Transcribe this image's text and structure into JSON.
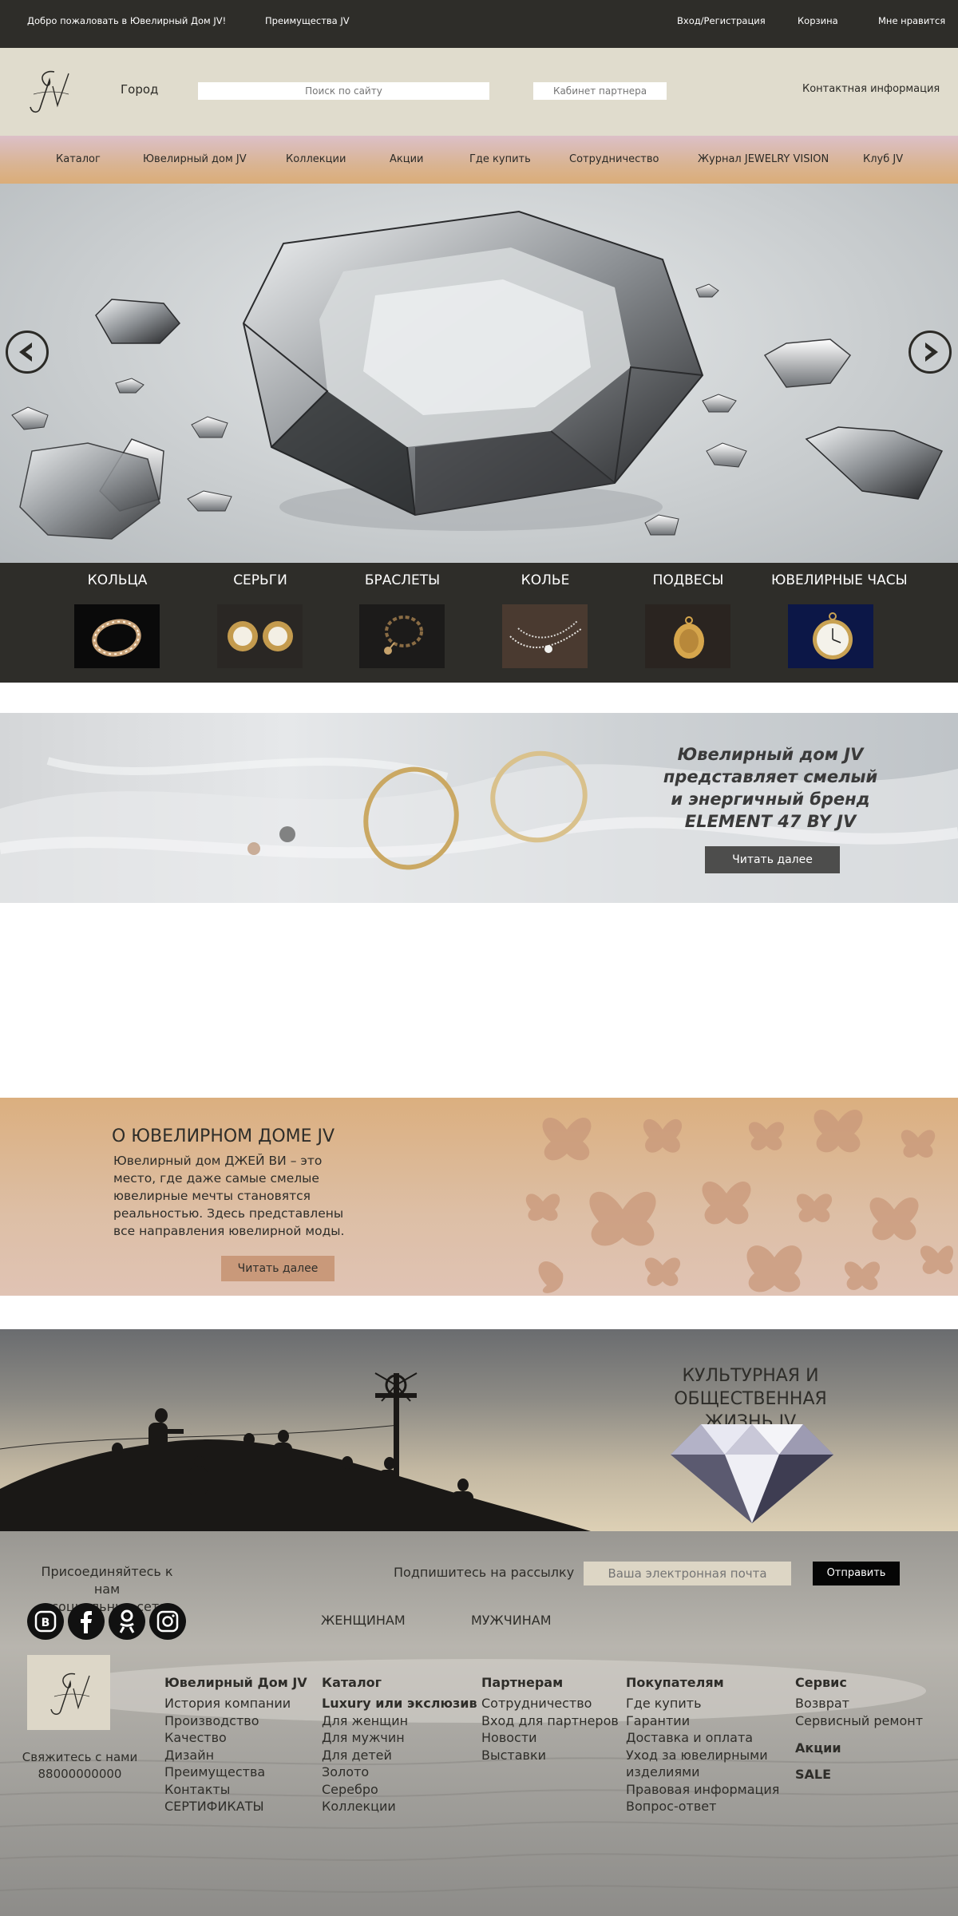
{
  "topbar": {
    "welcome": "Добро пожаловать в Ювелирный Дом JV!",
    "advantages": "Преимущества JV",
    "login": "Вход/Регистрация",
    "cart": "Корзина",
    "likes": "Мне нравится"
  },
  "header": {
    "city": "Город",
    "search_placeholder": "Поиск по сайту",
    "cabinet_placeholder": "Кабинет партнера",
    "contacts": "Контактная информация"
  },
  "nav": {
    "items": [
      "Каталог",
      "Ювелирный дом JV",
      "Коллекции",
      "Акции",
      "Где купить",
      "Сотрудничество",
      "Журнал JEWELRY VISION",
      "Клуб JV"
    ]
  },
  "categories": [
    "КОЛЬЦА",
    "СЕРЬГИ",
    "БРАСЛЕТЫ",
    "КОЛЬЕ",
    "ПОДВЕСЫ",
    "ЮВЕЛИРНЫЕ ЧАСЫ"
  ],
  "brand_banner": {
    "headline": "Ювелирный дом JV\nпредставляет смелый\nи энергичный бренд\nELEMENT 47 BY JV",
    "button": "Читать далее"
  },
  "about": {
    "title": "О ЮВЕЛИРНОМ ДОМЕ JV",
    "text": "Ювелирный дом ДЖЕЙ ВИ – это\nместо, где даже самые смелые\nювелирные мечты становятся\nреальностью. Здесь представлены\nвсе направления ювелирной моды.",
    "button": "Читать далее"
  },
  "culture": {
    "title": "КУЛЬТУРНАЯ И ОБЩЕСТВЕННАЯ\nЖИЗНЬ JV"
  },
  "footer": {
    "join": "Присоединяйтесь к нам\nв социальных сетях",
    "subscribe_label": "Подпишитесь на рассылку",
    "email_placeholder": "Ваша электронная почта",
    "send": "Отправить",
    "women": "ЖЕНЩИНАМ",
    "men": "МУЖЧИНАМ",
    "contact": "Свяжитесь с нами\n88000000000",
    "columns": [
      {
        "title": "Ювелирный Дом JV",
        "links": [
          "История компании",
          "Производство",
          "Качество",
          "Дизайн",
          "Преимущества",
          "Контакты",
          "СЕРТИФИКАТЫ"
        ]
      },
      {
        "title": "Каталог",
        "links": [
          "Luxury или экслюзив",
          "Для женщин",
          "Для мужчин",
          "Для детей",
          "Золото",
          "Серебро",
          "Коллекции"
        ]
      },
      {
        "title": "Партнерам",
        "links": [
          "Сотрудничество",
          "Вход для партнеров",
          "Новости",
          "Выставки"
        ]
      },
      {
        "title": "Покупателям",
        "links": [
          "Где купить",
          "Гарантии",
          "Доставка и оплата",
          "Уход за ювелирными",
          "изделиями",
          "Правовая информация",
          "Вопрос-ответ"
        ]
      },
      {
        "title": "Сервис",
        "links": [
          "Возврат",
          "Сервисный ремонт"
        ],
        "extra": [
          "Акции",
          "SALE"
        ]
      }
    ]
  },
  "icons": {
    "logo": "jv-monogram-logo",
    "arrow_left": "arrow-left-icon",
    "arrow_right": "arrow-right-icon",
    "social": [
      "vk-icon",
      "facebook-icon",
      "odnoklassniki-icon",
      "instagram-icon"
    ]
  },
  "colors": {
    "dark": "#2e2d29",
    "header_bg": "#e0dccd",
    "nav_gradient_top": "#dcc0c8",
    "nav_gradient_bottom": "#dbad78",
    "about_bg": "#dbaf7f",
    "button_dark": "#4d4d4c",
    "button_tan": "#c9997a",
    "send_button": "#050505"
  }
}
